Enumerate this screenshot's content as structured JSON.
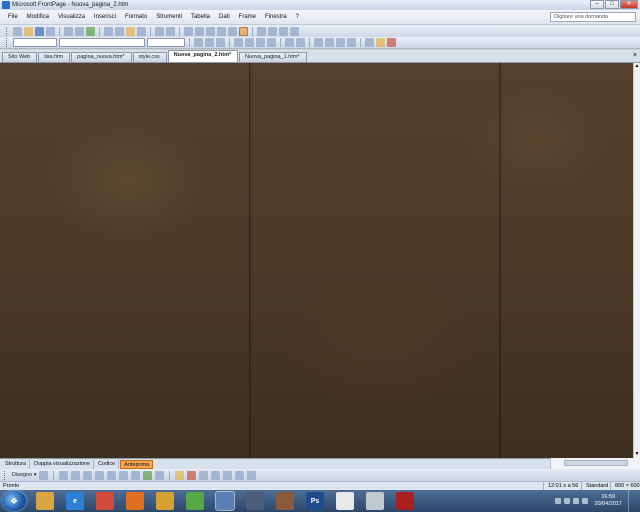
{
  "window": {
    "title": "Microsoft FrontPage - Nuova_pagina_2.htm",
    "minimize": "–",
    "maximize": "□",
    "close": "✕"
  },
  "menu": {
    "items": [
      "File",
      "Modifica",
      "Visualizza",
      "Inserisci",
      "Formato",
      "Strumenti",
      "Tabella",
      "Dati",
      "Frame",
      "Finestra",
      "?"
    ],
    "help_placeholder": "Digitare una domanda"
  },
  "tabs": {
    "items": [
      {
        "label": "Sito Web"
      },
      {
        "label": "lisa.htm"
      },
      {
        "label": "pagina_nuova.htm*"
      },
      {
        "label": "style.css"
      },
      {
        "label": "Nuova_pagina_2.htm*"
      },
      {
        "label": "Nuova_pagina_1.htm*"
      }
    ],
    "active_index": 4,
    "close_glyph": "×"
  },
  "view_modes": {
    "items": [
      "Struttura",
      "Doppia visualizzazione",
      "Codice",
      "Anteprima"
    ],
    "active_index": 3
  },
  "drawing_toolbar": {
    "label": "Disegno ▾"
  },
  "status": {
    "left": "Pronto",
    "size": "12:01 s a 56",
    "mode": "Standard",
    "dimensions": "800 × 600"
  },
  "taskbar": {
    "start_glyph": "❖",
    "apps": [
      {
        "name": "folder-icon",
        "glyph": "",
        "color": "#d9a441"
      },
      {
        "name": "internet-explorer-icon",
        "glyph": "e",
        "color": "#2d7fd4"
      },
      {
        "name": "chrome-icon",
        "glyph": "",
        "color": "#d24b3a"
      },
      {
        "name": "firefox-icon",
        "glyph": "",
        "color": "#e0701f"
      },
      {
        "name": "app-icon",
        "glyph": "",
        "color": "#d8a030"
      },
      {
        "name": "app-green-icon",
        "glyph": "",
        "color": "#55a845"
      },
      {
        "name": "frontpage-icon",
        "glyph": "",
        "color": "#5b7fb5"
      },
      {
        "name": "app-icon",
        "glyph": "",
        "color": "#4b5d78"
      },
      {
        "name": "app-icon",
        "glyph": "",
        "color": "#8a5a3a"
      },
      {
        "name": "photoshop-icon",
        "glyph": "Ps",
        "color": "#1e4b8a"
      },
      {
        "name": "app-icon",
        "glyph": "",
        "color": "#e8e8e8"
      },
      {
        "name": "app-icon",
        "glyph": "",
        "color": "#c0c8d2"
      },
      {
        "name": "app-icon",
        "glyph": "",
        "color": "#aa1f1f"
      }
    ],
    "clock_time": "16:59",
    "clock_date": "20/04/2017"
  }
}
